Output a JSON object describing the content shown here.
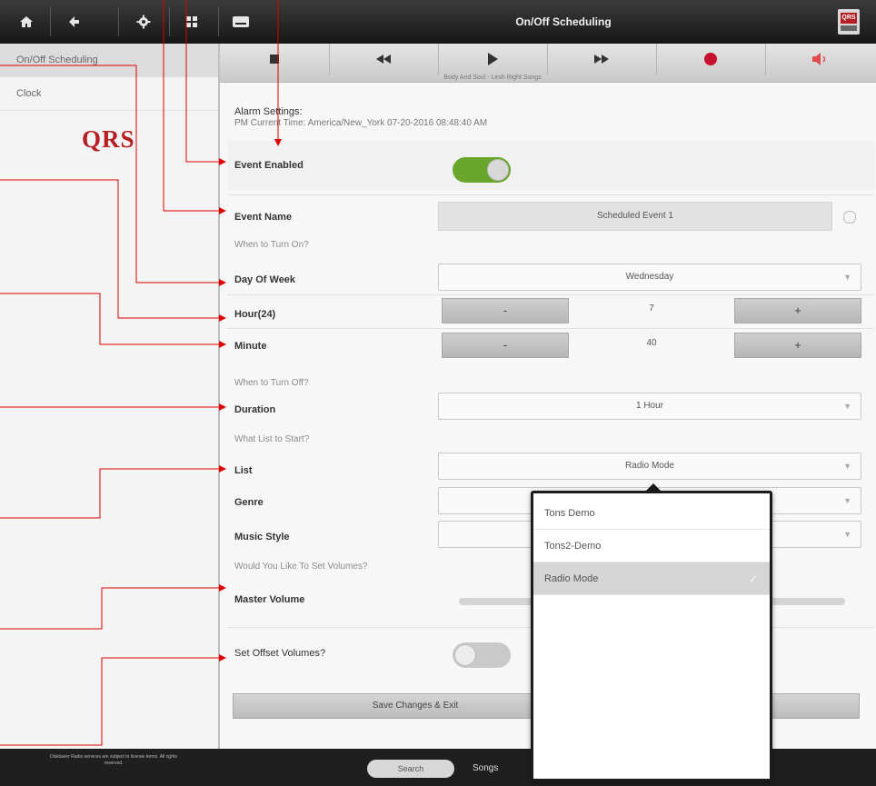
{
  "topbar": {
    "title": "On/Off Scheduling",
    "icons": [
      "home-icon",
      "back-icon",
      "gear-icon",
      "grid-icon",
      "keyboard-icon"
    ],
    "brand_badge": "QRS"
  },
  "sidebar": {
    "items": [
      {
        "label": "On/Off Scheduling"
      },
      {
        "label": "Clock"
      }
    ],
    "logo": "QRS"
  },
  "player": {
    "controls": [
      "stop-icon",
      "rewind-icon",
      "play-icon",
      "fast-forward-icon",
      "record-icon",
      "volume-icon"
    ],
    "now_playing": "Body And Soul - Lesh Right Songs"
  },
  "alarm": {
    "heading": "Alarm Settings:",
    "subheading": "PM Current Time: America/New_York 07-20-2016 08:48:40 AM"
  },
  "form": {
    "event_enabled_label": "Event Enabled",
    "event_enabled": true,
    "event_name_label": "Event Name",
    "event_name_value": "Scheduled Event 1",
    "when_on_label": "When to Turn On?",
    "day_of_week_label": "Day Of Week",
    "day_of_week_value": "Wednesday",
    "hour_label": "Hour(24)",
    "hour_value": "7",
    "minute_label": "Minute",
    "minute_value": "40",
    "minus": "-",
    "plus": "+",
    "when_off_label": "When to Turn Off?",
    "duration_label": "Duration",
    "duration_value": "1 Hour",
    "what_label": "What List to Start?",
    "list_label": "List",
    "list_value": "Radio Mode",
    "genre_label": "Genre",
    "music_style_label": "Music Style",
    "volumes_question": "Would You Like To Set Volumes?",
    "master_volume_label": "Master Volume",
    "offset_label": "Set Offset Volumes?",
    "offset_enabled": false,
    "save_label": "Save Changes & Exit"
  },
  "popup": {
    "items": [
      {
        "label": "Tons Demo",
        "selected": false
      },
      {
        "label": "Tons2-Demo",
        "selected": false
      },
      {
        "label": "Radio Mode",
        "selected": true
      }
    ]
  },
  "footer": {
    "note": "Disklavier Radio services are subject to license terms. All rights reserved.",
    "search_label": "Search",
    "songs_label": "Songs"
  }
}
